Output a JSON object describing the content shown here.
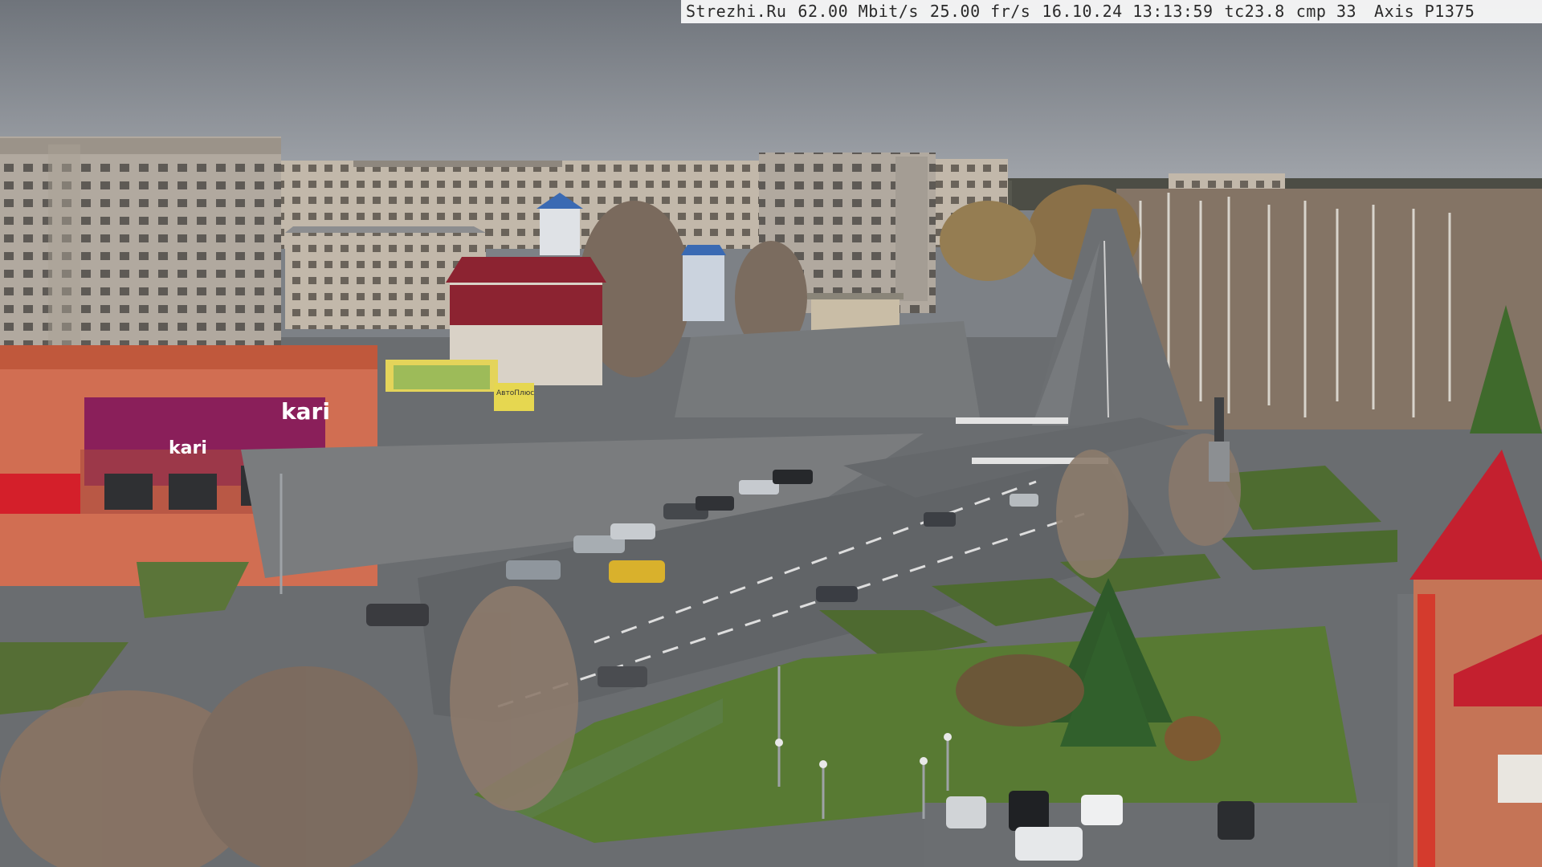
{
  "overlay": {
    "site": "Strezhi.Ru",
    "bitrate": "62.00 Mbit/s",
    "framerate": "25.00 fr/s",
    "datetime": "16.10.24 13:13:59",
    "tc": "tc23.8",
    "cmp": "cmp 33",
    "camera": "Axis P1375"
  },
  "signs": {
    "store_main": "kari",
    "store_side": "kari",
    "shop_small": "AвтоПлюс"
  },
  "colors": {
    "sky": "#8d9298",
    "asphalt": "#6b6e71",
    "grass": "#4f6e32",
    "kari_brand": "#8a1f5a",
    "roof_red": "#c4202f",
    "building_grey": "#b3aba2"
  }
}
